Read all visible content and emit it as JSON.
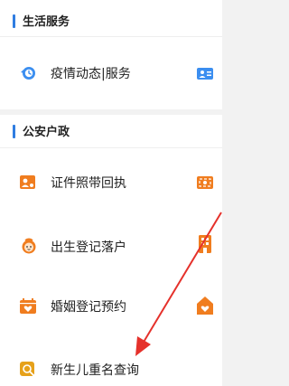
{
  "colors": {
    "section_bar": "#2f7de1",
    "blue_icon": "#3b8ef0",
    "orange_icon": "#f07d1f",
    "arrow": "#e5312b"
  },
  "sections": [
    {
      "title": "生活服务",
      "items": [
        {
          "label": "疫情动态|服务",
          "icon": "clock-refresh-icon",
          "right_icon": "id-card-icon"
        }
      ]
    },
    {
      "title": "公安户政",
      "items": [
        {
          "label": "证件照带回执",
          "icon": "photo-id-icon",
          "right_icon": "camera-frame-icon"
        },
        {
          "label": "出生登记落户",
          "icon": "baby-face-icon",
          "right_icon": "building-icon"
        },
        {
          "label": "婚姻登记预约",
          "icon": "calendar-heart-icon",
          "right_icon": "house-heart-icon"
        },
        {
          "label": "新生儿重名查询",
          "icon": "search-badge-icon",
          "right_icon": ""
        }
      ]
    }
  ]
}
